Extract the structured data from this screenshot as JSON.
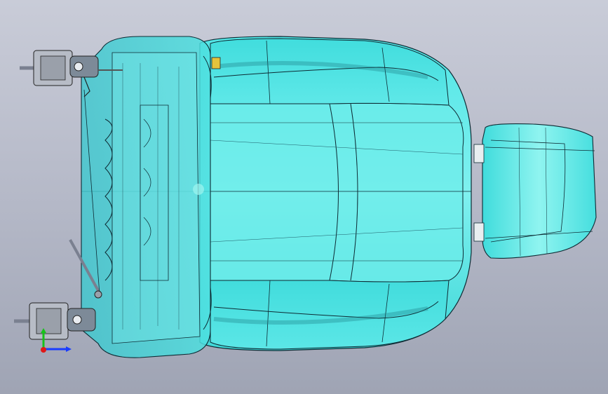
{
  "viewport": {
    "background_top": "#c9ccd8",
    "background_bottom": "#9fa4b4"
  },
  "model": {
    "part_color": "#3fe0e0",
    "edge_color": "#0d2a33",
    "hardware_color": "#9aa0aa"
  },
  "triad": {
    "x_axis_color": "#1a3cff",
    "y_axis_color": "#17c21a",
    "origin_color": "#e01818"
  }
}
